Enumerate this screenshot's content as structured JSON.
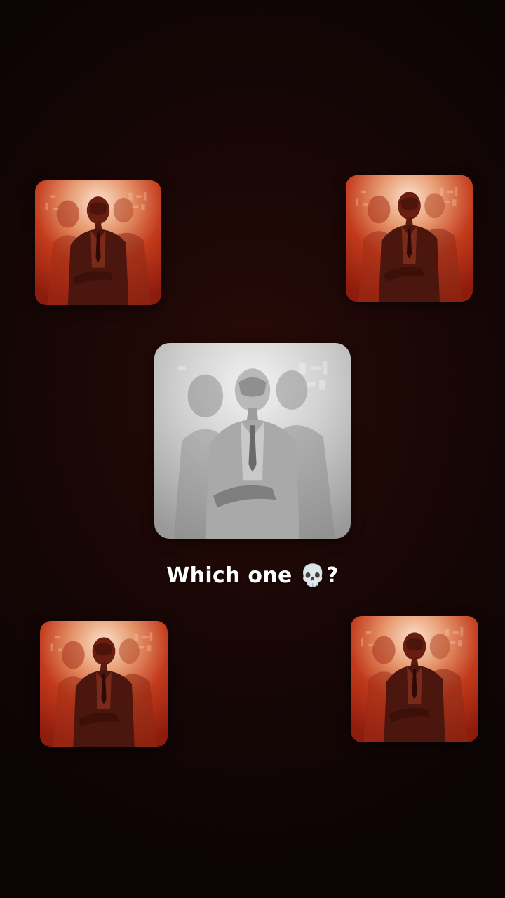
{
  "caption": {
    "text": "Which one",
    "emoji": "💀",
    "suffix": "?"
  },
  "tiles": [
    {
      "position": "top-left",
      "variant": "red",
      "icon": "masked-figure-poster-red"
    },
    {
      "position": "top-right",
      "variant": "red",
      "icon": "masked-figure-poster-red"
    },
    {
      "position": "center",
      "variant": "grayscale",
      "icon": "masked-figure-poster-gray"
    },
    {
      "position": "bottom-left",
      "variant": "red",
      "icon": "masked-figure-poster-red"
    },
    {
      "position": "bottom-right",
      "variant": "red",
      "icon": "masked-figure-poster-red"
    }
  ],
  "colors": {
    "background": "#120606",
    "red_variant_light": "#f3c5a6",
    "red_variant_dark": "#b12a12",
    "gray_variant_light": "#e9e9e9",
    "gray_variant_dark": "#8d8d8d",
    "caption": "#ffffff"
  }
}
